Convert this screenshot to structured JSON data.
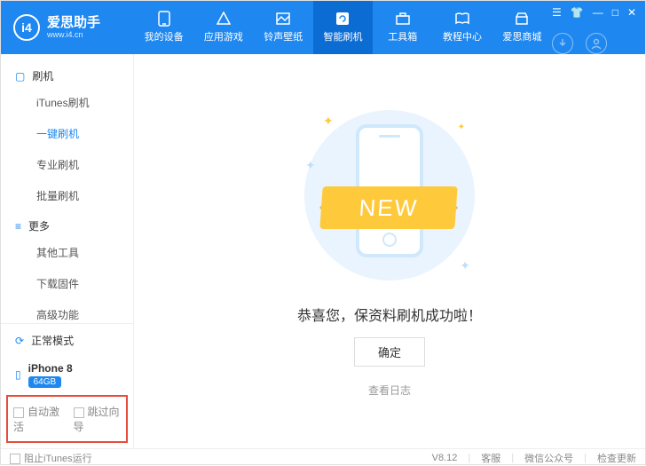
{
  "logo": {
    "mark": "i4",
    "name": "爱思助手",
    "url": "www.i4.cn"
  },
  "nav": [
    {
      "label": "我的设备"
    },
    {
      "label": "应用游戏"
    },
    {
      "label": "铃声壁纸"
    },
    {
      "label": "智能刷机"
    },
    {
      "label": "工具箱"
    },
    {
      "label": "教程中心"
    },
    {
      "label": "爱思商城"
    }
  ],
  "sidebar": {
    "group1": "刷机",
    "items1": [
      "iTunes刷机",
      "一键刷机",
      "专业刷机",
      "批量刷机"
    ],
    "group2": "更多",
    "items2": [
      "其他工具",
      "下载固件",
      "高级功能"
    ],
    "mode": "正常模式",
    "device": "iPhone 8",
    "storage": "64GB",
    "opt1": "自动激活",
    "opt2": "跳过向导"
  },
  "main": {
    "ribbon": "NEW",
    "success": "恭喜您，保资料刷机成功啦！",
    "confirm": "确定",
    "log": "查看日志"
  },
  "footer": {
    "block_itunes": "阻止iTunes运行",
    "version": "V8.12",
    "support": "客服",
    "wechat": "微信公众号",
    "update": "检查更新"
  }
}
